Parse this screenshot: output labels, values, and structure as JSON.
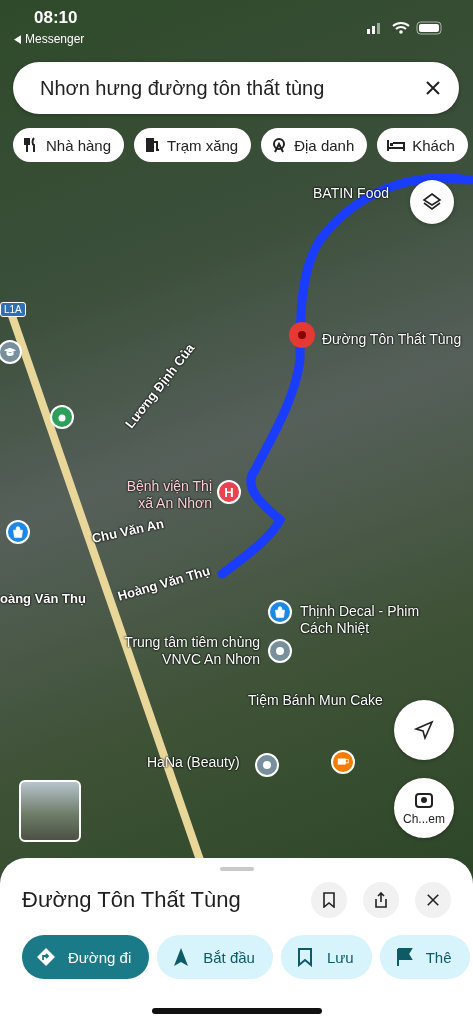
{
  "status_bar": {
    "time": "08:10",
    "back_app": "Messenger"
  },
  "search": {
    "value": "Nhơn hưng đường tôn thất tùng"
  },
  "chips": [
    {
      "label": "Nhà hàng",
      "kind": "restaurant"
    },
    {
      "label": "Trạm xăng",
      "kind": "gas"
    },
    {
      "label": "Địa danh",
      "kind": "landmark"
    },
    {
      "label": "Khách",
      "kind": "hotel"
    }
  ],
  "map": {
    "labels": [
      {
        "text": "BATIN Food",
        "kind": "place"
      },
      {
        "text": "Đường Tôn Thất Tùng",
        "kind": "place"
      },
      {
        "text": "Lương Định Của",
        "kind": "street"
      },
      {
        "text": "Bệnh viện Thị xã An Nhơn",
        "kind": "hospital"
      },
      {
        "text": "Chu Văn An",
        "kind": "street"
      },
      {
        "text": "oàng Văn Thụ",
        "kind": "street"
      },
      {
        "text": "Hoàng Văn Thụ",
        "kind": "street"
      },
      {
        "text": "Thịnh Decal - Phim Cách Nhiệt",
        "kind": "place"
      },
      {
        "text": "Trung tâm tiêm chủng VNVC An Nhơn",
        "kind": "place"
      },
      {
        "text": "Tiệm Bánh Mun Cake",
        "kind": "place"
      },
      {
        "text": "HaNa (Beauty)",
        "kind": "place"
      }
    ],
    "road_shield": "L1A",
    "pins": [
      {
        "kind": "selected",
        "color": "#e53935"
      },
      {
        "kind": "hospital",
        "color": "#e8434f",
        "glyph": "H"
      },
      {
        "kind": "shop",
        "color": "#1e88e5"
      },
      {
        "kind": "shop",
        "color": "#1e88e5"
      },
      {
        "kind": "generic",
        "color": "#78909c"
      },
      {
        "kind": "generic",
        "color": "#78909c"
      },
      {
        "kind": "cafe",
        "color": "#f57c00"
      },
      {
        "kind": "school",
        "color": "#78909c"
      },
      {
        "kind": "park",
        "color": "#2e9e5b"
      }
    ],
    "lens_label": "Ch...em"
  },
  "place": {
    "title": "Đường Tôn Thất Tùng",
    "actions": [
      {
        "label": "Đường đi",
        "kind": "directions",
        "primary": true
      },
      {
        "label": "Bắt đầu",
        "kind": "start",
        "primary": false
      },
      {
        "label": "Lưu",
        "kind": "save",
        "primary": false
      },
      {
        "label": "Thê",
        "kind": "flag",
        "primary": false
      }
    ]
  }
}
